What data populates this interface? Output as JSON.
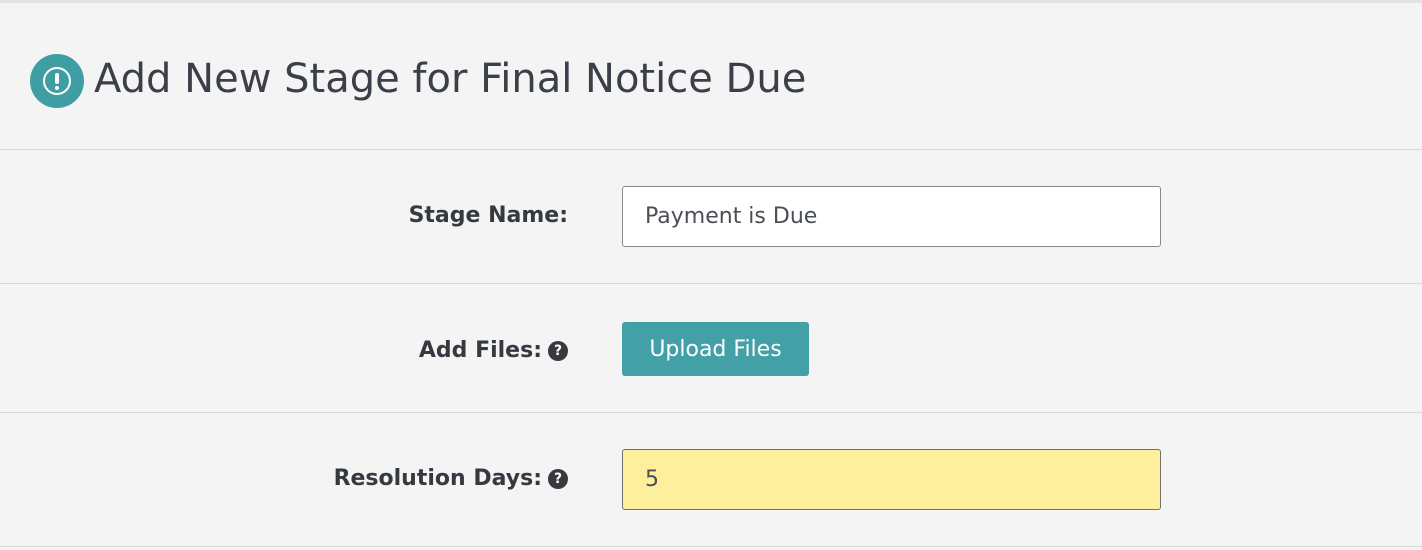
{
  "header": {
    "icon": "alert-circle-icon",
    "title": "Add New Stage for Final Notice Due",
    "accent_color": "#3f9ea4"
  },
  "form": {
    "stage_name": {
      "label": "Stage Name:",
      "value": "Payment is Due"
    },
    "add_files": {
      "label": "Add Files:",
      "help_icon": "question-circle-icon",
      "help_glyph": "?",
      "button_label": "Upload Files",
      "button_color": "#42a0a6"
    },
    "resolution_days": {
      "label": "Resolution Days:",
      "help_icon": "question-circle-icon",
      "help_glyph": "?",
      "value": "5",
      "highlight_color": "#fdef9b"
    }
  }
}
